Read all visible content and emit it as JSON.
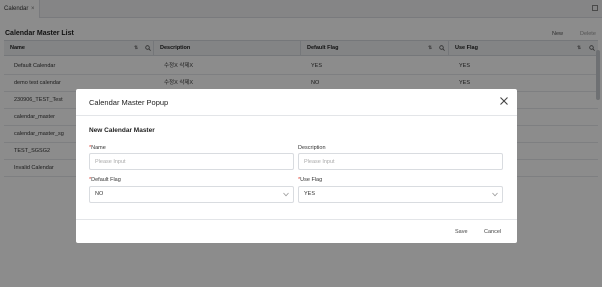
{
  "tab": {
    "label": "Calendar",
    "close": "×"
  },
  "page": {
    "title": "Calendar Master List",
    "new_label": "New",
    "delete_label": "Delete"
  },
  "grid": {
    "columns": [
      "Name",
      "Description",
      "Default Flag",
      "Use Flag"
    ],
    "sort_glyph": "⇅",
    "rows": [
      {
        "name": "Default Calendar",
        "desc": "수정X 삭제X",
        "def": "YES",
        "use": "YES"
      },
      {
        "name": "demo test calendar",
        "desc": "수정X 삭제X",
        "def": "NO",
        "use": "YES"
      },
      {
        "name": "230906_TEST_Test",
        "desc": "",
        "def": "",
        "use": ""
      },
      {
        "name": "calendar_master",
        "desc": "",
        "def": "",
        "use": ""
      },
      {
        "name": "calendar_master_sg",
        "desc": "",
        "def": "",
        "use": ""
      },
      {
        "name": "TEST_SGSG2",
        "desc": "",
        "def": "",
        "use": ""
      },
      {
        "name": "Invalid Calendar",
        "desc": "",
        "def": "",
        "use": ""
      }
    ]
  },
  "modal": {
    "title": "Calendar Master Popup",
    "section_title": "New Calendar Master",
    "required_mark": "*",
    "name_label": "Name",
    "name_placeholder": "Please Input",
    "description_label": "Description",
    "description_placeholder": "Please Input",
    "default_flag_label": "Default Flag",
    "default_flag_value": "NO",
    "use_flag_label": "Use Flag",
    "use_flag_value": "YES",
    "save_label": "Save",
    "cancel_label": "Cancel"
  }
}
